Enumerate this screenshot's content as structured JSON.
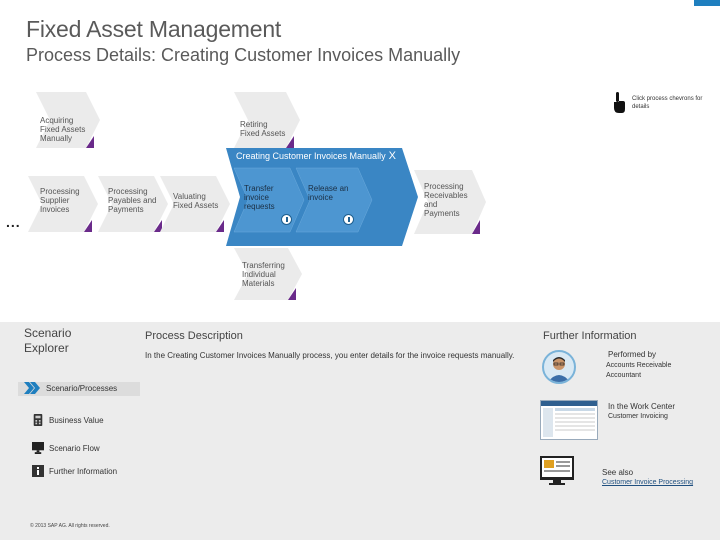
{
  "header": {
    "title": "Fixed Asset Management",
    "subtitle": "Process Details: Creating Customer Invoices Manually"
  },
  "hint": {
    "text": "Click process chevrons for details"
  },
  "process_map": {
    "upper": [
      {
        "label": "Acquiring Fixed Assets Manually"
      },
      {
        "label": "Retiring Fixed Assets"
      }
    ],
    "middle": [
      {
        "label": "Processing Supplier Invoices"
      },
      {
        "label": "Processing Payables and Payments"
      },
      {
        "label": "Valuating Fixed Assets"
      },
      {
        "label": "Processing Receivables and Payments"
      }
    ],
    "active": {
      "title": "Creating Customer Invoices Manually",
      "close": "X",
      "steps": [
        {
          "label": "Transfer invoice requests"
        },
        {
          "label": "Release an invoice"
        }
      ]
    },
    "lower": [
      {
        "label": "Transferring Individual Materials"
      }
    ],
    "more": "..."
  },
  "explorer": {
    "title_line1": "Scenario",
    "title_line2": "Explorer",
    "items": [
      {
        "label": "Scenario/Processes",
        "icon": "double-chevron-icon",
        "selected": true
      },
      {
        "label": "Business Value",
        "icon": "calculator-icon"
      },
      {
        "label": "Scenario Flow",
        "icon": "monitor-icon"
      },
      {
        "label": "Further Information",
        "icon": "info-icon"
      }
    ],
    "copyright": "© 2013 SAP AG. All rights reserved."
  },
  "process_description": {
    "title": "Process Description",
    "text": "In the Creating Customer Invoices Manually process, you enter details for the invoice requests manually."
  },
  "further_information": {
    "title": "Further Information",
    "performed_by_label": "Performed by",
    "performed_by_value": "Accounts Receivable Accountant",
    "work_center_label": "In the Work Center",
    "work_center_value": "Customer Invoicing",
    "see_also_label": "See also",
    "see_also_link": "Customer Invoice Processing"
  },
  "colors": {
    "chevron": "#ebebeb",
    "active": "#3a86c4",
    "active_dark": "#1f5f93",
    "accent_purple": "#6a2a8a",
    "accent_blue": "#1f7fbf",
    "panel_bg": "#ececec"
  }
}
